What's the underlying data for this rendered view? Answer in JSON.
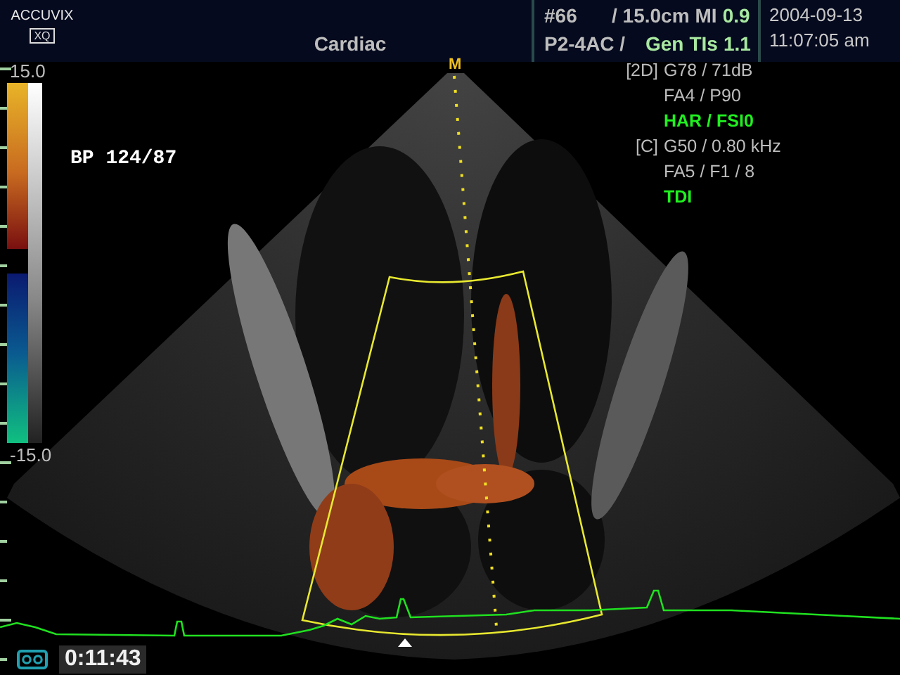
{
  "header": {
    "logo": "ACCUVIX",
    "logo_badge": "XQ",
    "exam": "Cardiac",
    "frame": "#66",
    "depth": "/ 15.0cm",
    "mi_label": "MI",
    "mi_value": "0.9",
    "probe": "P2-4AC /",
    "tis_mode": "Gen",
    "tis_label": "TIs",
    "tis_value": "1.1",
    "date": "2004-09-13",
    "time": "11:07:05 am"
  },
  "color_scale": {
    "max": "15.0",
    "min": "-15.0"
  },
  "bp": "BP 124/87",
  "marker": "M",
  "params": [
    {
      "tag": "[2D]",
      "text": "G78 / 71dB",
      "kind": "setting"
    },
    {
      "text": "FA4 / P90",
      "kind": "setting"
    },
    {
      "text": "HAR / FSI0",
      "kind": "mode"
    },
    {
      "tag": "[C]",
      "text": "G50 / 0.80 kHz",
      "kind": "setting"
    },
    {
      "text": "FA5 / F1 / 8",
      "kind": "setting"
    },
    {
      "text": "TDI",
      "kind": "mode"
    }
  ],
  "cine": {
    "time": "0:11:43"
  }
}
